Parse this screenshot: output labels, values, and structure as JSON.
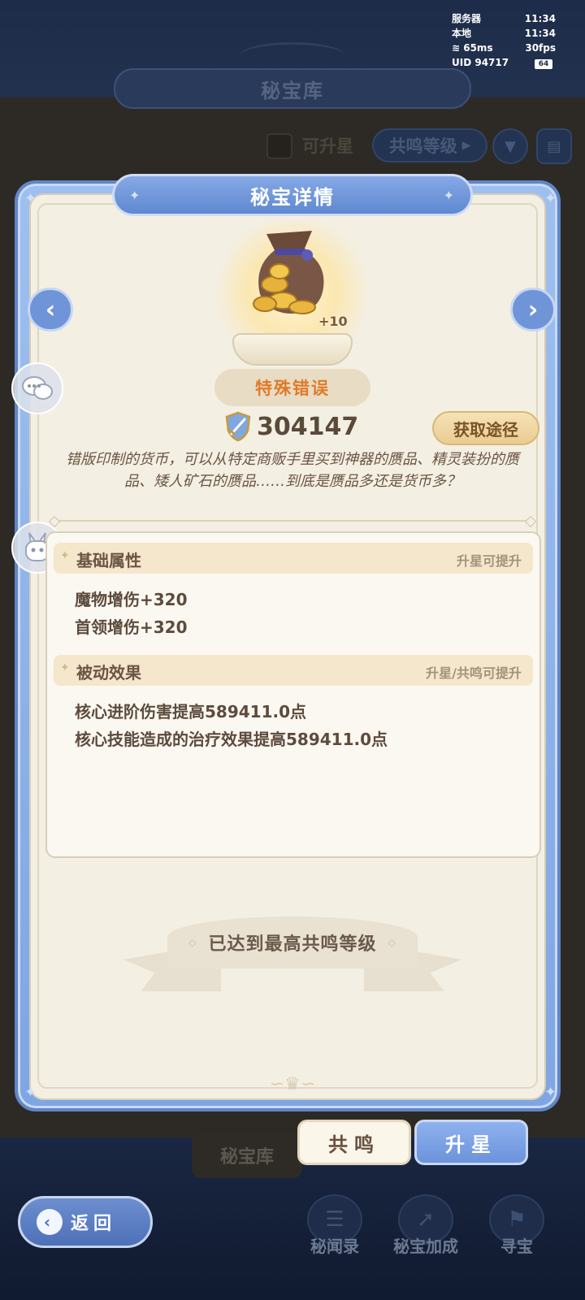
{
  "status": {
    "server_label": "服务器",
    "server_time": "11:34",
    "local_label": "本地",
    "local_time": "11:34",
    "ping": "65ms",
    "fps": "30fps",
    "uid": "UID  94717",
    "battery": "64"
  },
  "background": {
    "title": "秘宝库",
    "upgradable_label": "可升星",
    "resonance_level_button": "共鸣等级",
    "treasury_tab": "秘宝库"
  },
  "panel": {
    "title": "秘宝详情",
    "item": {
      "level_tag": "+10",
      "name": "特殊错误",
      "name_color": "#e07a2a",
      "power": "304147",
      "obtain_button": "获取途径",
      "description": "错版印制的货币，可以从特定商贩手里买到神器的赝品、精灵装扮的赝品、矮人矿石的赝品……到底是赝品多还是货币多？"
    },
    "basic_attributes": {
      "title": "基础属性",
      "hint": "升星可提升",
      "lines": [
        "魔物增伤+320",
        "首领增伤+320"
      ]
    },
    "passive_effects": {
      "title": "被动效果",
      "hint": "升星/共鸣可提升",
      "lines": [
        "核心进阶伤害提高589411.0点",
        "核心技能造成的治疗效果提高589411.0点"
      ]
    },
    "max_banner": "已达到最高共鸣等级"
  },
  "tabs": {
    "resonance": "共鸣",
    "star_up": "升星",
    "active": "star_up"
  },
  "back_button": "返回",
  "bottom_nav": [
    {
      "label": "秘闻录",
      "icon": "scroll-icon"
    },
    {
      "label": "秘宝加成",
      "icon": "boost-icon"
    },
    {
      "label": "寻宝",
      "icon": "treasure-hunt-icon"
    }
  ],
  "colors": {
    "accent_blue": "#6f95d8",
    "panel_bg": "#f4efe3",
    "name_orange": "#e07a2a"
  }
}
